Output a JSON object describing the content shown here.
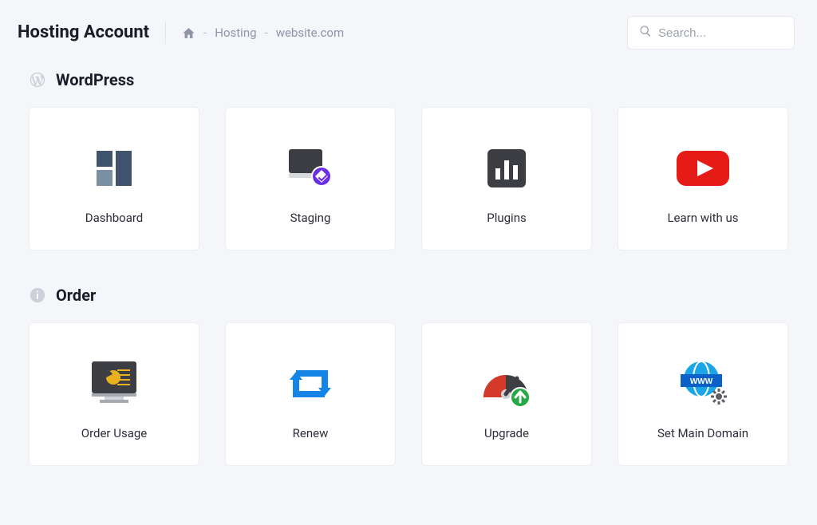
{
  "page_title": "Hosting Account",
  "breadcrumb": {
    "home_icon": "home-icon",
    "items": [
      "Hosting",
      "website.com"
    ]
  },
  "search": {
    "placeholder": "Search..."
  },
  "sections": [
    {
      "key": "wordpress",
      "title": "WordPress",
      "icon": "wordpress-icon",
      "cards": [
        {
          "label": "Dashboard",
          "icon": "dashboard-icon"
        },
        {
          "label": "Staging",
          "icon": "staging-icon"
        },
        {
          "label": "Plugins",
          "icon": "plugins-icon"
        },
        {
          "label": "Learn with us",
          "icon": "youtube-icon"
        }
      ]
    },
    {
      "key": "order",
      "title": "Order",
      "icon": "info-icon",
      "cards": [
        {
          "label": "Order Usage",
          "icon": "order-usage-icon"
        },
        {
          "label": "Renew",
          "icon": "renew-icon"
        },
        {
          "label": "Upgrade",
          "icon": "upgrade-icon"
        },
        {
          "label": "Set Main Domain",
          "icon": "set-main-domain-icon"
        }
      ]
    }
  ]
}
